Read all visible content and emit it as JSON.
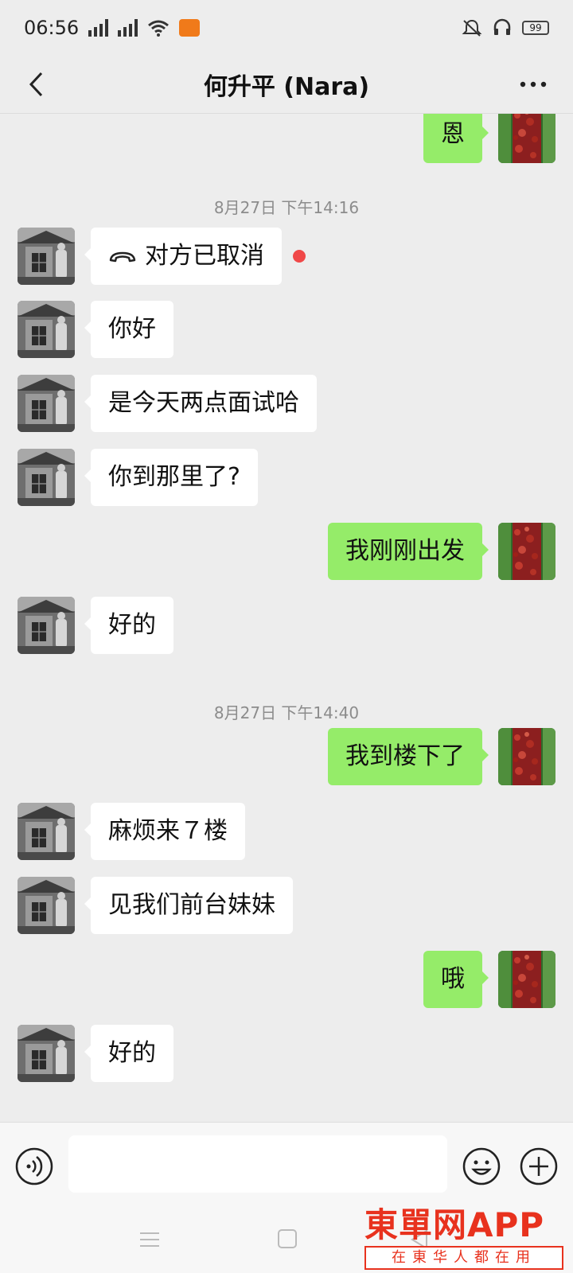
{
  "status_bar": {
    "time": "06:56",
    "battery": "99",
    "icons": [
      "signal-icon",
      "signal-icon",
      "wifi-icon",
      "app-badge-icon",
      "mute-icon",
      "headset-icon",
      "battery-icon"
    ]
  },
  "header": {
    "title": "何升平 (Nara)",
    "back_icon": "chevron-left-icon",
    "more_icon": "more-dots-icon"
  },
  "messages": [
    {
      "type": "out",
      "text": "恩"
    },
    {
      "type": "time",
      "text": "8月27日 下午14:16"
    },
    {
      "type": "in",
      "text": "对方已取消",
      "icon": "hangup-icon",
      "unread": true
    },
    {
      "type": "in",
      "text": "你好"
    },
    {
      "type": "in",
      "text": "是今天两点面试哈"
    },
    {
      "type": "in",
      "text": "你到那里了?"
    },
    {
      "type": "out",
      "text": "我刚刚出发"
    },
    {
      "type": "in",
      "text": "好的"
    },
    {
      "type": "time",
      "text": "8月27日 下午14:40"
    },
    {
      "type": "out",
      "text": "我到楼下了"
    },
    {
      "type": "in",
      "text": "麻烦来７楼"
    },
    {
      "type": "in",
      "text": "见我们前台妹妹"
    },
    {
      "type": "out",
      "text": "哦"
    },
    {
      "type": "in",
      "text": "好的"
    }
  ],
  "input_bar": {
    "value": "",
    "voice_icon": "voice-icon",
    "emoji_icon": "emoji-icon",
    "plus_icon": "plus-icon"
  },
  "watermark": {
    "title": "東單网APP",
    "subtitle": "在東华人都在用"
  },
  "colors": {
    "background": "#ededed",
    "incoming_bubble": "#ffffff",
    "outgoing_bubble": "#95ec69",
    "unread_dot": "#f04848",
    "watermark": "#e8321e"
  }
}
